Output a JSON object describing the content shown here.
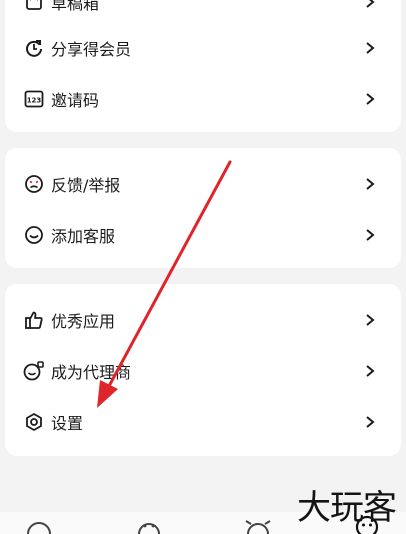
{
  "group1": {
    "items": [
      {
        "label": "草稿箱",
        "icon": "draft-icon"
      },
      {
        "label": "分享得会员",
        "icon": "share-refresh-icon"
      },
      {
        "label": "邀请码",
        "icon": "code-123-icon"
      }
    ]
  },
  "group2": {
    "items": [
      {
        "label": "反馈/举报",
        "icon": "feedback-face-icon"
      },
      {
        "label": "添加客服",
        "icon": "customer-service-icon"
      }
    ]
  },
  "group3": {
    "items": [
      {
        "label": "优秀应用",
        "icon": "thumbs-up-icon"
      },
      {
        "label": "成为代理商",
        "icon": "agent-icon"
      },
      {
        "label": "设置",
        "icon": "settings-icon"
      }
    ]
  },
  "watermark": "大玩客",
  "colors": {
    "accent_arrow": "#e0242b",
    "card": "#ffffff",
    "background": "#f3f3f3"
  }
}
